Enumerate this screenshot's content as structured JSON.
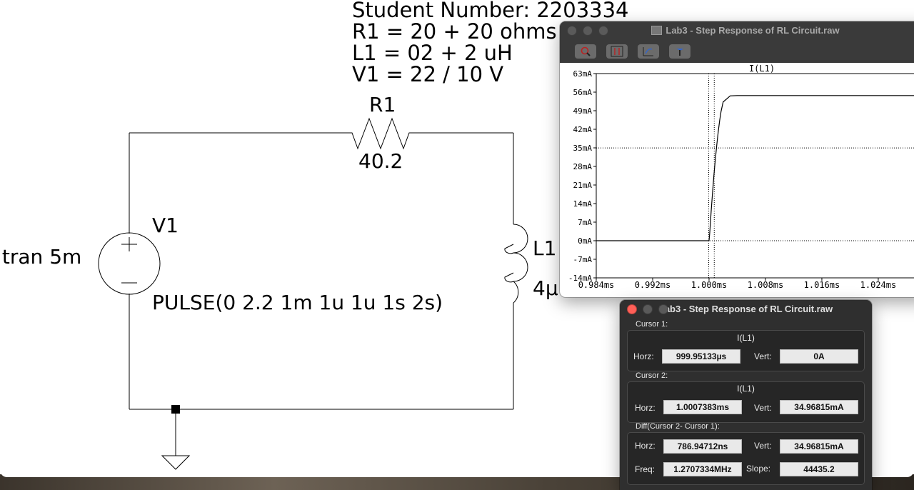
{
  "schematic": {
    "student_number": "Student Number: 2203334",
    "r1_note": "R1 = 20 + 20 ohms",
    "l1_note": "L1 = 02 + 2 uH",
    "v1_note": "V1 = 22 / 10 V",
    "r1_label": "R1",
    "r1_value": "40.2",
    "v1_label": "V1",
    "v1_source": "PULSE(0 2.2 1m 1u 1u 1s 2s)",
    "tran_directive": ".tran 5m",
    "l1_label": "L1",
    "l1_value": "4µ"
  },
  "plot_window": {
    "title": "Lab3 - Step Response of RL Circuit.raw",
    "trace_label": "I(L1)",
    "toolbar": [
      "zoom-icon",
      "autorange-icon",
      "undo-zoom-icon",
      "pan-icon"
    ]
  },
  "chart_data": {
    "type": "line",
    "title": "",
    "xlabel": "",
    "ylabel": "",
    "x_tick_labels": [
      "0.984ms",
      "0.992ms",
      "1.000ms",
      "1.008ms",
      "1.016ms",
      "1.024ms"
    ],
    "y_tick_labels": [
      "63mA",
      "56mA",
      "49mA",
      "42mA",
      "35mA",
      "28mA",
      "21mA",
      "14mA",
      "7mA",
      "0mA",
      "-7mA",
      "-14mA"
    ],
    "ylim": [
      -14,
      63
    ],
    "xlim": [
      0.984,
      1.0315
    ],
    "series": [
      {
        "name": "I(L1)",
        "color": "#000000",
        "x": [
          0.984,
          1.0,
          1.0001,
          1.0003,
          1.0005,
          1.0007,
          1.0009,
          1.0011,
          1.0013,
          1.0015,
          1.0017,
          1.002,
          1.003,
          1.004,
          1.0315
        ],
        "y": [
          0,
          0,
          3.0,
          11.1,
          18.3,
          25.0,
          30.9,
          36.2,
          41.0,
          45.2,
          48.7,
          52.3,
          54.6,
          54.7,
          54.7
        ]
      }
    ],
    "cursors_x": [
      0.99995133,
      1.0007383
    ],
    "dotted_levels_y": [
      34.96815,
      0
    ]
  },
  "cursor_window": {
    "title": "Lab3 - Step Response of RL Circuit.raw",
    "cursor1": {
      "label": "Cursor 1:",
      "trace": "I(L1)",
      "horz_label": "Horz:",
      "horz": "999.95133µs",
      "vert_label": "Vert:",
      "vert": "0A"
    },
    "cursor2": {
      "label": "Cursor 2:",
      "trace": "I(L1)",
      "horz_label": "Horz:",
      "horz": "1.0007383ms",
      "vert_label": "Vert:",
      "vert": "34.96815mA"
    },
    "diff": {
      "label": "Diff(Cursor 2- Cursor 1):",
      "horz_label": "Horz:",
      "horz": "786.94712ns",
      "vert_label": "Vert:",
      "vert": "34.96815mA",
      "freq_label": "Freq:",
      "freq": "1.2707334MHz",
      "slope_label": "Slope:",
      "slope": "44435.2"
    }
  }
}
